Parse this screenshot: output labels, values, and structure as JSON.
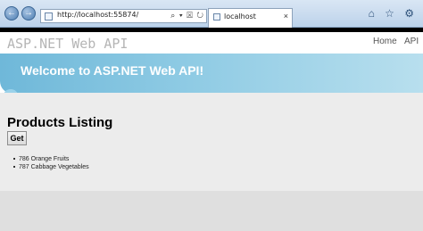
{
  "browser": {
    "address_url": "http://localhost:55874/",
    "address_icons": "⌕ ▾ ☒ ↻",
    "tab_title": "localhost",
    "tab_close": "×",
    "toolbar_icons": "⌂ ☆ ⚙",
    "back_glyph": "←",
    "forward_glyph": "→"
  },
  "site": {
    "title": "ASP.NET Web API",
    "nav": [
      "Home",
      "API"
    ]
  },
  "banner": {
    "heading": "Welcome to ASP.NET Web API!"
  },
  "main": {
    "heading": "Products Listing",
    "get_button": "Get",
    "products": [
      "786 Orange Fruits",
      "787 Cabbage Vegetables"
    ]
  }
}
